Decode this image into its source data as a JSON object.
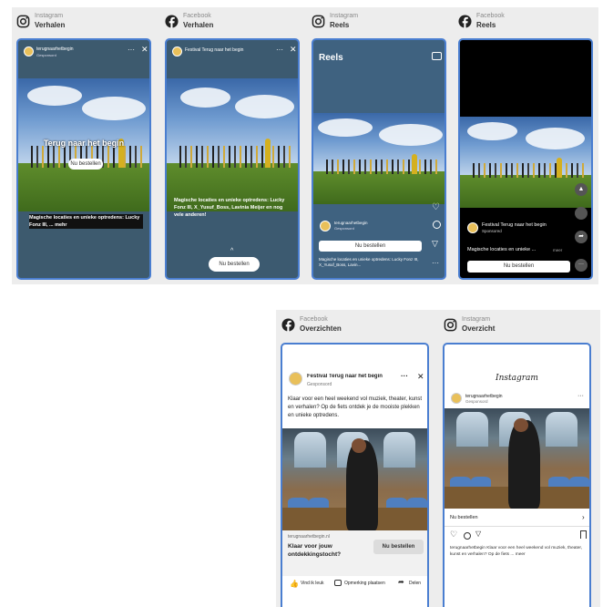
{
  "top": {
    "ig_stories": {
      "platform": "Instagram",
      "label": "Verhalen",
      "account": "terugnaarhetbegin",
      "sponsored": "Gesponsord",
      "headline": "Terug naar het begin",
      "cta": "Nu bestellen",
      "caption": "Magische locaties en unieke optredens: Lucky Fonz III, ... mehr"
    },
    "fb_stories": {
      "platform": "Facebook",
      "label": "Verhalen",
      "account": "Festival Terug naar het begin",
      "caption": "Magische locaties en unieke optredens: Lucky Fonz III, X_Yusuf_Boss, Lavinia Meijer en nog vele anderen!",
      "cta": "Nu bestellen"
    },
    "ig_reels": {
      "platform": "Instagram",
      "label": "Reels",
      "title": "Reels",
      "account": "terugnaarhetbegin",
      "sponsored": "Gesponsord",
      "cta": "Nu bestellen",
      "caption": "Magische locaties en unieke optredens: Lucky Fonz III, X_Yusuf_Boss, Lavin..."
    },
    "fb_reels": {
      "platform": "Facebook",
      "label": "Reels",
      "account": "Festival Terug naar het begin",
      "sponsored": "Sponsored",
      "caption": "Magische locaties en unieke ...",
      "more": "meer",
      "cta": "Nu bestellen"
    }
  },
  "bottom": {
    "fb_feed": {
      "platform": "Facebook",
      "label": "Overzichten",
      "account": "Festival Terug naar het begin",
      "sponsored": "Gesponsord",
      "text": "Klaar voor een heel weekend vol muziek, theater, kunst en verhalen? Op de fiets ontdek je de mooiste plekken en unieke optredens.",
      "domain": "terugnaarhetbegin.nl",
      "link_title": "Klaar voor jouw ontdekkingstocht?",
      "cta": "Nu bestellen",
      "like": "Vind ik leuk",
      "comment": "Opmerking plaatsen",
      "share": "Delen"
    },
    "ig_feed": {
      "platform": "Instagram",
      "label": "Overzicht",
      "logo": "Instagram",
      "account": "terugnaarhetbegin",
      "sponsored": "Gesponsord",
      "cta": "Nu bestellen",
      "caption": "terugnaarhetbegin Klaar voor een heel weekend vol muziek, theater, kunst en verhalen? Op de fiets ... meer"
    }
  },
  "colors": {
    "frame": "#4a7ed0",
    "panel": "#ededed"
  }
}
